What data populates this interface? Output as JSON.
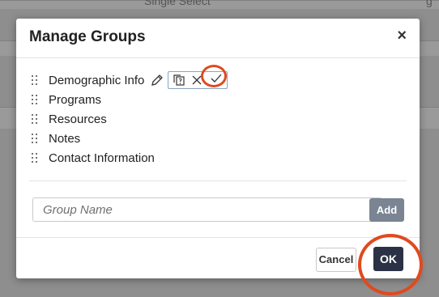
{
  "background": {
    "top_row_text": "Single Select",
    "top_row_trailing": "g"
  },
  "modal": {
    "title": "Manage Groups",
    "close_label": "×"
  },
  "groups": [
    {
      "label": "Demographic Info",
      "editing": true
    },
    {
      "label": "Programs"
    },
    {
      "label": "Resources"
    },
    {
      "label": "Notes"
    },
    {
      "label": "Contact Information"
    }
  ],
  "icons": {
    "drag": "drag-handle-icon",
    "edit": "pencil-icon",
    "copy": "copy-icon",
    "cancel": "x-icon",
    "confirm": "checkmark-icon"
  },
  "new_group": {
    "placeholder": "Group Name",
    "value": "",
    "add_label": "Add"
  },
  "footer": {
    "cancel_label": "Cancel",
    "ok_label": "OK"
  },
  "colors": {
    "highlight": "#e04a1f",
    "primary_button": "#2b3245",
    "add_button": "#7b8493"
  }
}
